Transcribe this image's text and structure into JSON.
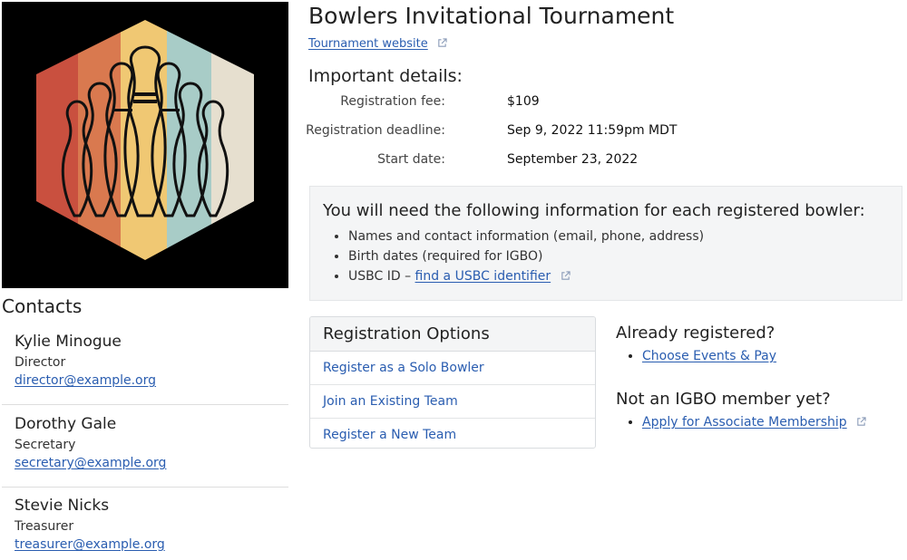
{
  "tournament": {
    "title": "Bowlers Invitational Tournament",
    "website_link": "Tournament website"
  },
  "details": {
    "heading": "Important details:",
    "rows": [
      {
        "label": "Registration fee:",
        "value": "$109"
      },
      {
        "label": "Registration deadline:",
        "value": "Sep 9, 2022 11:59pm MDT"
      },
      {
        "label": "Start date:",
        "value": "September 23, 2022"
      }
    ]
  },
  "info": {
    "heading": "You will need the following information for each registered bowler:",
    "items": [
      "Names and contact information (email, phone, address)",
      "Birth dates (required for IGBO)"
    ],
    "usbc_prefix": "USBC ID – ",
    "usbc_link": "find a USBC identifier"
  },
  "registration": {
    "heading": "Registration Options",
    "options": [
      "Register as a Solo Bowler",
      "Join an Existing Team",
      "Register a New Team"
    ]
  },
  "already": {
    "heading": "Already registered?",
    "link": "Choose Events & Pay"
  },
  "membership": {
    "heading": "Not an IGBO member yet?",
    "link": "Apply for Associate Membership"
  },
  "contacts": {
    "heading": "Contacts",
    "people": [
      {
        "name": "Kylie Minogue",
        "role": "Director",
        "email": "director@example.org"
      },
      {
        "name": "Dorothy Gale",
        "role": "Secretary",
        "email": "secretary@example.org"
      },
      {
        "name": "Stevie Nicks",
        "role": "Treasurer",
        "email": "treasurer@example.org"
      }
    ]
  },
  "logo": {
    "icon": "bowling-pins-logo",
    "stripe_colors": [
      "#c9503f",
      "#d9794f",
      "#f0c873",
      "#a8ccc7",
      "#e6dfcf"
    ]
  },
  "colors": {
    "link": "#2a5db0",
    "panel_bg": "#f4f5f6",
    "border": "#d9dcdf"
  }
}
